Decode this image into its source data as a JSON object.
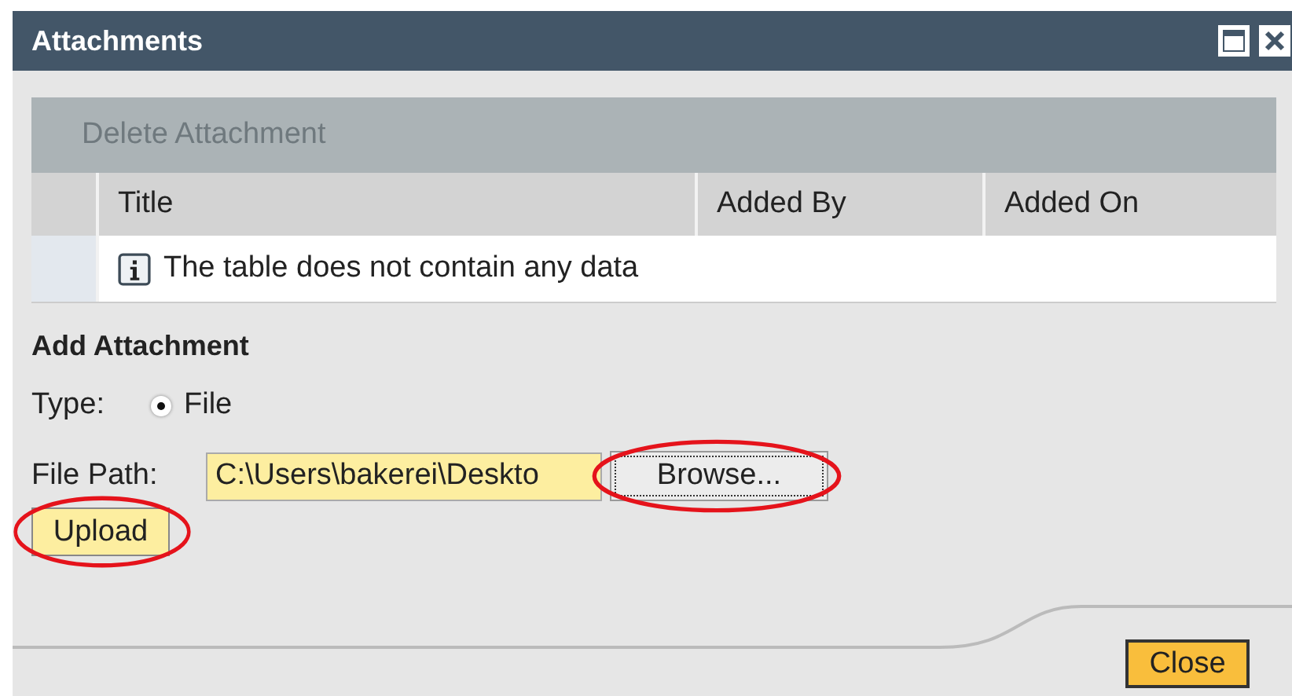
{
  "window": {
    "title": "Attachments",
    "controls": [
      {
        "kind": "maximize"
      },
      {
        "kind": "close"
      }
    ]
  },
  "toolbar": {
    "buttons": [
      {
        "label": "Delete Attachment",
        "disabled": true
      }
    ]
  },
  "table": {
    "columns": [
      "Title",
      "Added By",
      "Added On"
    ],
    "empty_message": "The table does not contain any data"
  },
  "add_attachment": {
    "heading": "Add Attachment",
    "type_label": "Type:",
    "type_options": [
      {
        "label": "File",
        "selected": true
      }
    ],
    "path_label": "File Path:",
    "path_value": "C:\\Users\\bakerei\\Deskto",
    "browse": {
      "label": "Browse...",
      "highlighted": true
    },
    "upload": {
      "label": "Upload",
      "highlighted": true
    }
  },
  "footer": {
    "buttons": [
      "Close"
    ]
  }
}
